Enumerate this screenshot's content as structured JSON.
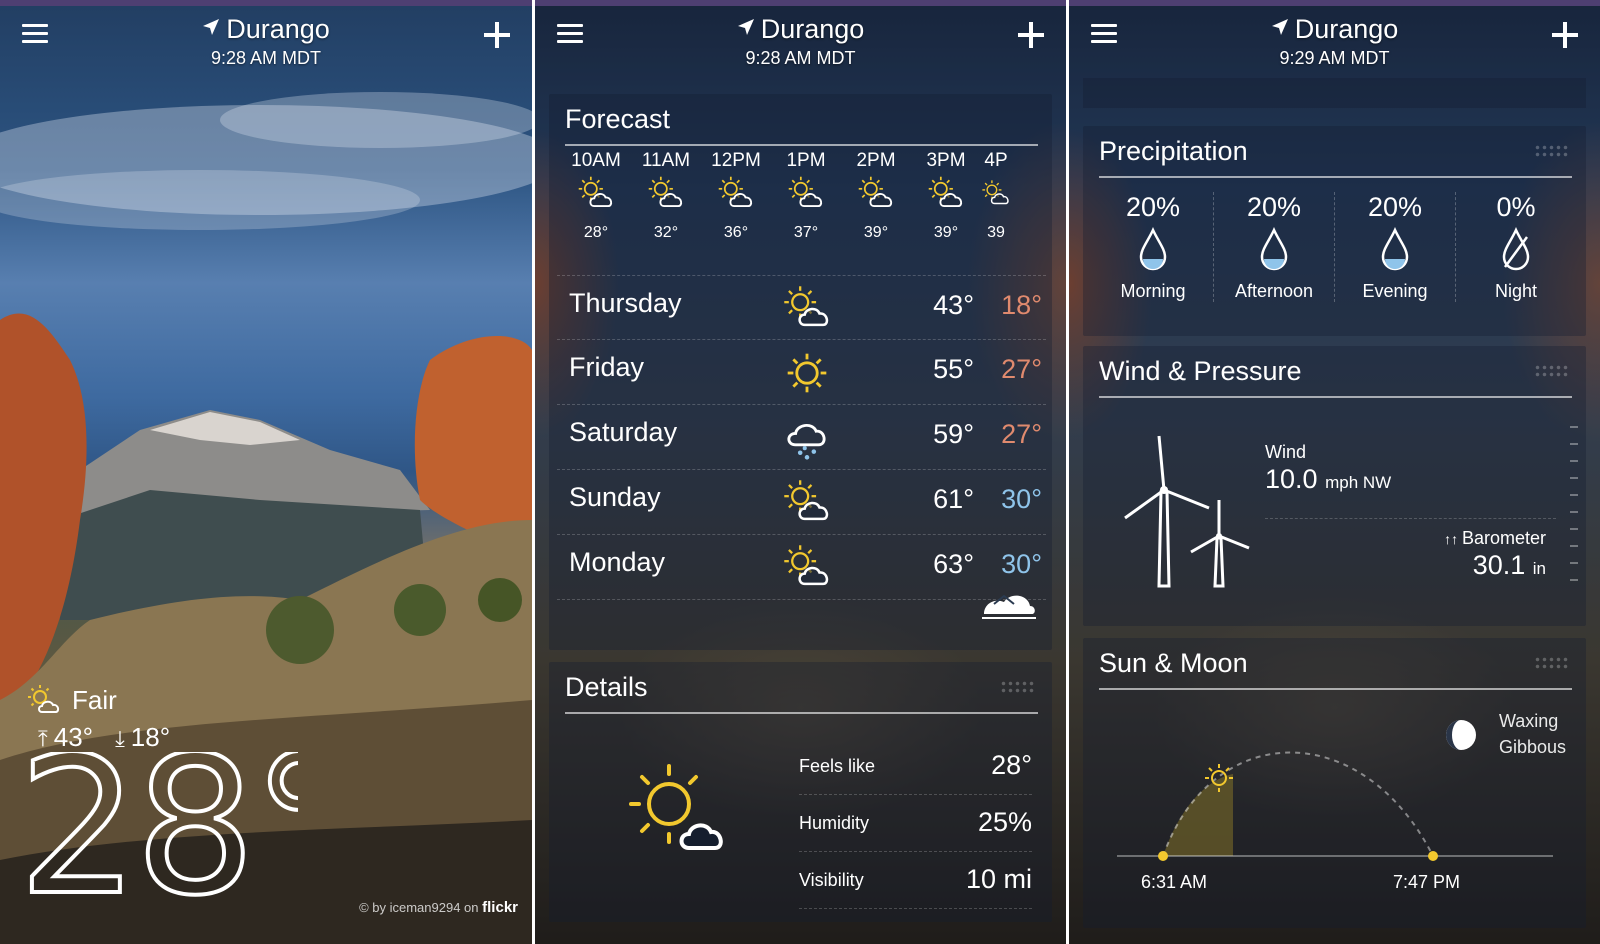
{
  "panels": [
    {
      "city": "Durango",
      "time": "9:28 AM MDT",
      "condition": "Fair",
      "high": "43°",
      "low": "18°",
      "current_temp": "28°",
      "credit_prefix": "© by iceman9294 on",
      "credit_brand": "flickr"
    },
    {
      "city": "Durango",
      "time": "9:28 AM MDT",
      "forecast": {
        "title": "Forecast",
        "hourly": [
          {
            "time": "10AM",
            "temp": "28°",
            "icon": "partly-sunny-icon"
          },
          {
            "time": "11AM",
            "temp": "32°",
            "icon": "partly-sunny-icon"
          },
          {
            "time": "12PM",
            "temp": "36°",
            "icon": "partly-sunny-icon"
          },
          {
            "time": "1PM",
            "temp": "37°",
            "icon": "partly-sunny-icon"
          },
          {
            "time": "2PM",
            "temp": "39°",
            "icon": "partly-sunny-icon"
          },
          {
            "time": "3PM",
            "temp": "39°",
            "icon": "partly-sunny-icon"
          },
          {
            "time": "4P",
            "temp": "39",
            "icon": "partly-sunny-icon"
          }
        ],
        "daily": [
          {
            "day": "Thursday",
            "high": "43°",
            "low": "18°",
            "icon": "partly-cloudy-icon"
          },
          {
            "day": "Friday",
            "high": "55°",
            "low": "27°",
            "icon": "sun-icon"
          },
          {
            "day": "Saturday",
            "high": "59°",
            "low": "27°",
            "icon": "rain-cloud-icon"
          },
          {
            "day": "Sunday",
            "high": "61°",
            "low": "30°",
            "icon": "partly-sunny-icon"
          },
          {
            "day": "Monday",
            "high": "63°",
            "low": "30°",
            "icon": "partly-sunny-icon"
          }
        ],
        "provider_logo": "weather-underground-logo-icon"
      },
      "details": {
        "title": "Details",
        "rows": [
          {
            "label": "Feels like",
            "value": "28°"
          },
          {
            "label": "Humidity",
            "value": "25%"
          },
          {
            "label": "Visibility",
            "value": "10 mi"
          }
        ]
      }
    },
    {
      "city": "Durango",
      "time": "9:29 AM MDT",
      "precipitation": {
        "title": "Precipitation",
        "periods": [
          {
            "pct": "20%",
            "label": "Morning"
          },
          {
            "pct": "20%",
            "label": "Afternoon"
          },
          {
            "pct": "20%",
            "label": "Evening"
          },
          {
            "pct": "0%",
            "label": "Night"
          }
        ]
      },
      "wind": {
        "title": "Wind & Pressure",
        "wind_label": "Wind",
        "wind_value": "10.0",
        "wind_unit": "mph NW",
        "baro_label": "Barometer",
        "baro_value": "30.1",
        "baro_unit": "in"
      },
      "sun_moon": {
        "title": "Sun & Moon",
        "moon_phase_line1": "Waxing",
        "moon_phase_line2": "Gibbous",
        "sunrise": "6:31 AM",
        "sunset": "7:47 PM"
      }
    }
  ],
  "colors": {
    "sun_yellow": "#f2c82e",
    "low_warm": "#e08a6e",
    "low_cold": "#8fc4ea",
    "header_bar": "#4e3f72"
  }
}
